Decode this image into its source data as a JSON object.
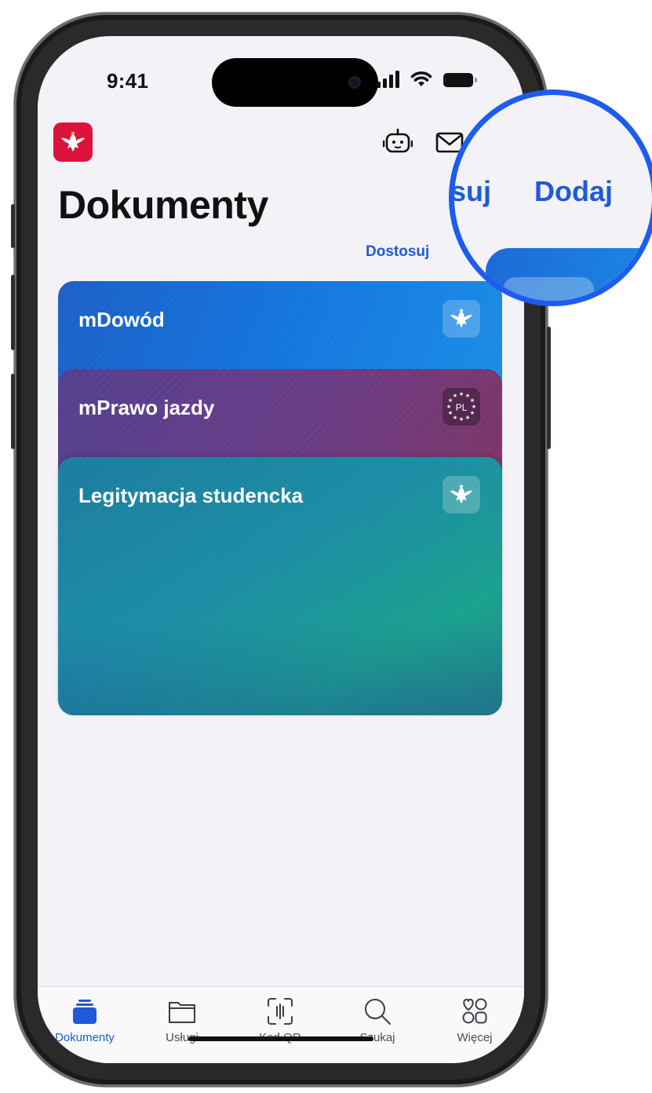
{
  "status_bar": {
    "time": "9:41"
  },
  "header": {
    "title": "Dokumenty",
    "dostosuj_label": "Dostosuj",
    "icons": [
      "robot-icon",
      "mail-icon"
    ]
  },
  "magnifier": {
    "partial_label": "suj",
    "add_label": "Dodaj"
  },
  "documents": [
    {
      "label": "mDowód",
      "badge": "eagle-emblem-icon",
      "color": "#1476de"
    },
    {
      "label": "mPrawo jazdy",
      "badge_text": "PL",
      "badge": "eu-stars-icon",
      "color": "#6a3c86"
    },
    {
      "label": "Legitymacja studencka",
      "badge": "eagle-emblem-icon",
      "color": "#1b8ea4"
    }
  ],
  "tabbar": {
    "tabs": [
      {
        "label": "Dokumenty",
        "icon": "stack-icon",
        "active": true
      },
      {
        "label": "Usługi",
        "icon": "folder-icon",
        "active": false
      },
      {
        "label": "Kod QR",
        "icon": "qr-scan-icon",
        "active": false
      },
      {
        "label": "Szukaj",
        "icon": "search-icon",
        "active": false
      },
      {
        "label": "Więcej",
        "icon": "more-grid-icon",
        "active": false
      }
    ]
  },
  "colors": {
    "accent": "#1f5ad8",
    "emblem": "#dc143c",
    "magnifier_ring": "#1e5cf0"
  }
}
